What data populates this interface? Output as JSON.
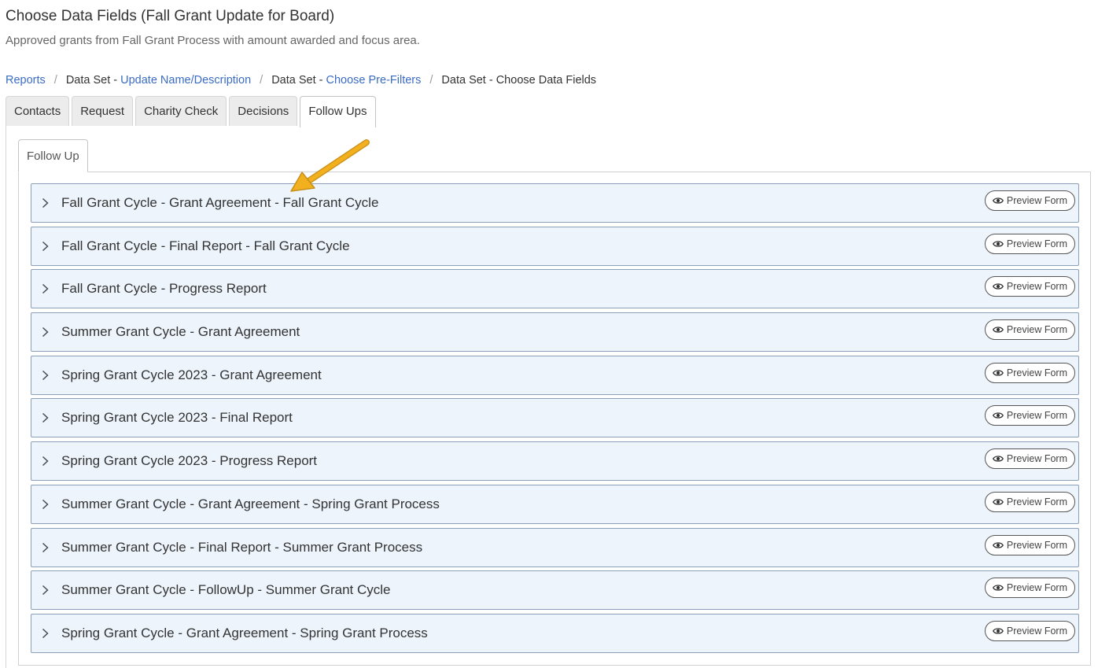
{
  "header": {
    "title": "Choose Data Fields (Fall Grant Update for Board)",
    "subtitle": "Approved grants from Fall Grant Process with amount awarded and focus area."
  },
  "breadcrumb": {
    "reports": "Reports",
    "separator": "/",
    "ds_prefix_1": "Data Set - ",
    "ds_link_1": "Update Name/Description",
    "ds_prefix_2": "Data Set - ",
    "ds_link_2": "Choose Pre-Filters",
    "ds_current": "Data Set - Choose Data Fields"
  },
  "tabs": [
    {
      "label": "Contacts"
    },
    {
      "label": "Request"
    },
    {
      "label": "Charity Check"
    },
    {
      "label": "Decisions"
    },
    {
      "label": "Follow Ups",
      "active": true
    }
  ],
  "inner_tab": {
    "label": "Follow Up"
  },
  "preview_label": "Preview Form",
  "items": [
    {
      "label": "Fall Grant Cycle - Grant Agreement - Fall Grant Cycle"
    },
    {
      "label": "Fall Grant Cycle - Final Report - Fall Grant Cycle"
    },
    {
      "label": "Fall Grant Cycle - Progress Report"
    },
    {
      "label": "Summer Grant Cycle - Grant Agreement"
    },
    {
      "label": "Spring Grant Cycle 2023 - Grant Agreement"
    },
    {
      "label": "Spring Grant Cycle 2023 - Final Report"
    },
    {
      "label": "Spring Grant Cycle 2023 - Progress Report"
    },
    {
      "label": "Summer Grant Cycle - Grant Agreement - Spring Grant Process"
    },
    {
      "label": "Summer Grant Cycle - Final Report - Summer Grant Process"
    },
    {
      "label": "Summer Grant Cycle - FollowUp - Summer Grant Cycle"
    },
    {
      "label": "Spring Grant Cycle - Grant Agreement - Spring Grant Process"
    }
  ],
  "icons": {
    "chevron": "chevron-right-icon",
    "preview": "eye-icon",
    "annotation": "arrow-annotation"
  },
  "colors": {
    "link": "#3b6cc5",
    "row_background": "#edf4fc",
    "row_border": "#8aa0b8",
    "annotation_arrow": "#f2b01e"
  }
}
